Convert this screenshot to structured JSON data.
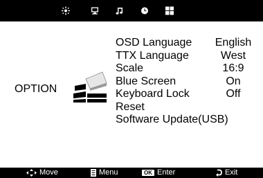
{
  "top_tabs": [
    {
      "icon": "picture-icon"
    },
    {
      "icon": "monitor-icon"
    },
    {
      "icon": "music-note-icon"
    },
    {
      "icon": "clock-icon"
    },
    {
      "icon": "grid-icon"
    }
  ],
  "section": {
    "label": "OPTION",
    "icon": "option-blocks-icon"
  },
  "menu": {
    "items": [
      {
        "label": "OSD Language",
        "value": "English"
      },
      {
        "label": "TTX Language",
        "value": "West"
      },
      {
        "label": "Scale",
        "value": "16:9"
      },
      {
        "label": "Blue Screen",
        "value": "On"
      },
      {
        "label": "Keyboard Lock",
        "value": "Off"
      },
      {
        "label": "Reset",
        "value": ""
      },
      {
        "label": "Software Update(USB)",
        "value": ""
      }
    ]
  },
  "footer": {
    "move": {
      "icon": "move-arrows-icon",
      "label": "Move"
    },
    "menu": {
      "icon": "menu-icon",
      "label": "Menu"
    },
    "enter": {
      "badge": "OK",
      "label": "Enter"
    },
    "exit": {
      "icon": "return-icon",
      "label": "Exit"
    }
  }
}
